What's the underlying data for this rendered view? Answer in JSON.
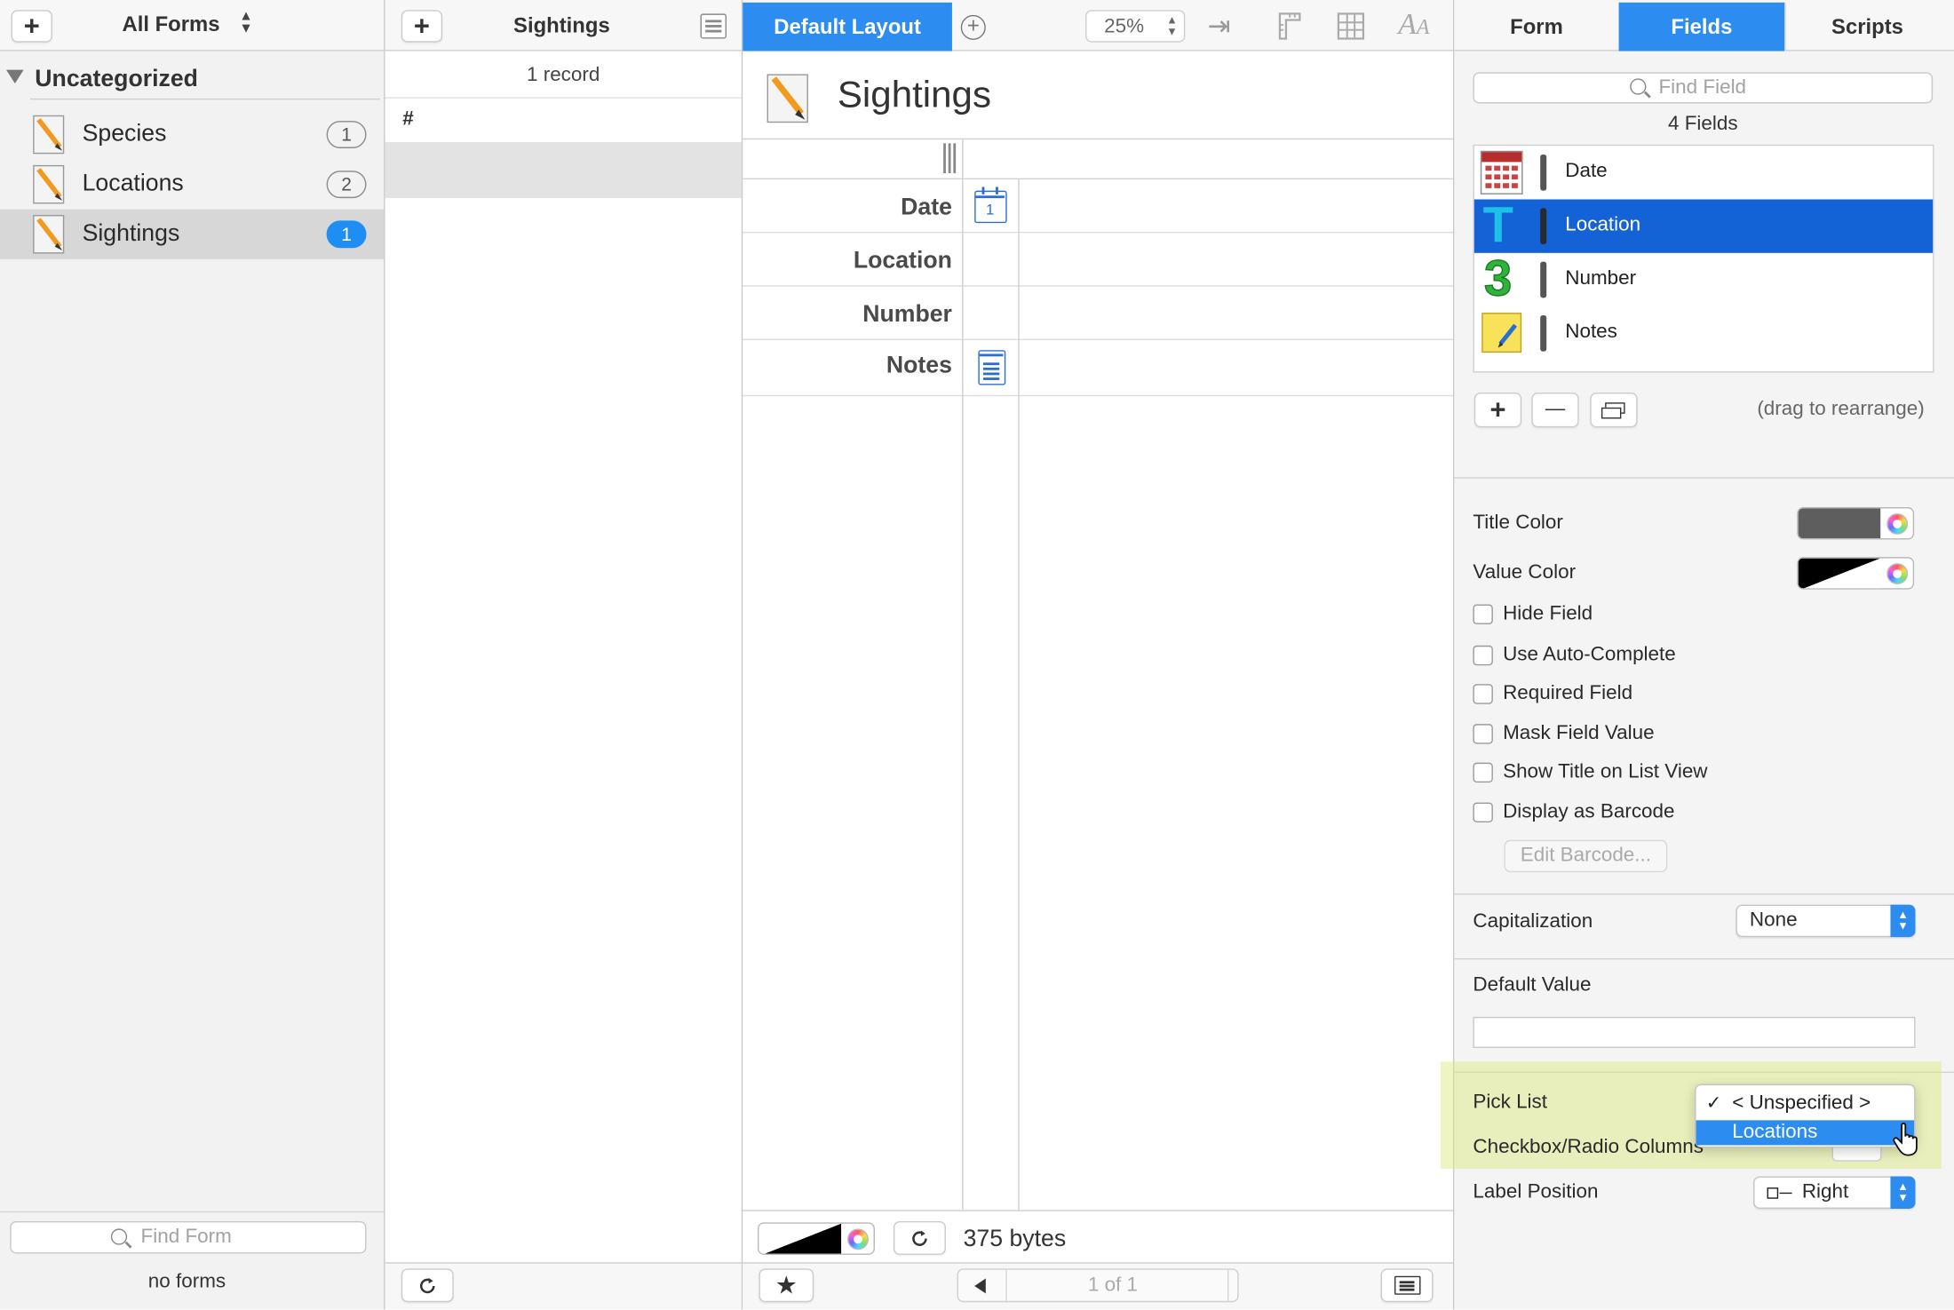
{
  "sidebar": {
    "add_label": "+",
    "forms_popup": "All Forms",
    "group_label": "Uncategorized",
    "items": [
      {
        "label": "Species",
        "count": "1"
      },
      {
        "label": "Locations",
        "count": "2"
      },
      {
        "label": "Sightings",
        "count": "1"
      }
    ],
    "search_placeholder": "Find Form",
    "status": "no forms"
  },
  "records": {
    "add_label": "+",
    "title": "Sightings",
    "count_label": "1 record",
    "column_header": "#"
  },
  "layout": {
    "tab_label": "Default Layout",
    "zoom": "25%",
    "form_title": "Sightings",
    "fields": [
      "Date",
      "Location",
      "Number",
      "Notes"
    ],
    "date_icon_day": "1",
    "size_label": "375 bytes",
    "pager": "1 of 1"
  },
  "inspector": {
    "tabs": [
      "Form",
      "Fields",
      "Scripts"
    ],
    "active_tab": "Fields",
    "search_placeholder": "Find Field",
    "fields_count": "4 Fields",
    "fields": [
      {
        "name": "Date",
        "icon": "calendar-icon"
      },
      {
        "name": "Location",
        "icon": "text-t-icon",
        "selected": true
      },
      {
        "name": "Number",
        "icon": "number-3-icon"
      },
      {
        "name": "Notes",
        "icon": "note-icon"
      }
    ],
    "add_label": "+",
    "remove_label": "—",
    "drag_hint": "(drag to rearrange)",
    "title_color_label": "Title Color",
    "value_color_label": "Value Color",
    "checkboxes": [
      "Hide Field",
      "Use Auto-Complete",
      "Required Field",
      "Mask Field Value",
      "Show Title on List View",
      "Display as Barcode"
    ],
    "edit_barcode_label": "Edit Barcode...",
    "capitalization_label": "Capitalization",
    "capitalization_value": "None",
    "default_value_label": "Default Value",
    "default_value": "",
    "pick_list_label": "Pick List",
    "pick_list_menu": [
      {
        "label": "< Unspecified >",
        "checked": true
      },
      {
        "label": "Locations",
        "highlighted": true
      }
    ],
    "checkbox_columns_label": "Checkbox/Radio Columns",
    "label_position_label": "Label Position",
    "label_position_value": "Right"
  },
  "colors": {
    "accent": "#2d8cf0",
    "selection": "#1463d6",
    "highlight_overlay": "#e8f0a4"
  }
}
